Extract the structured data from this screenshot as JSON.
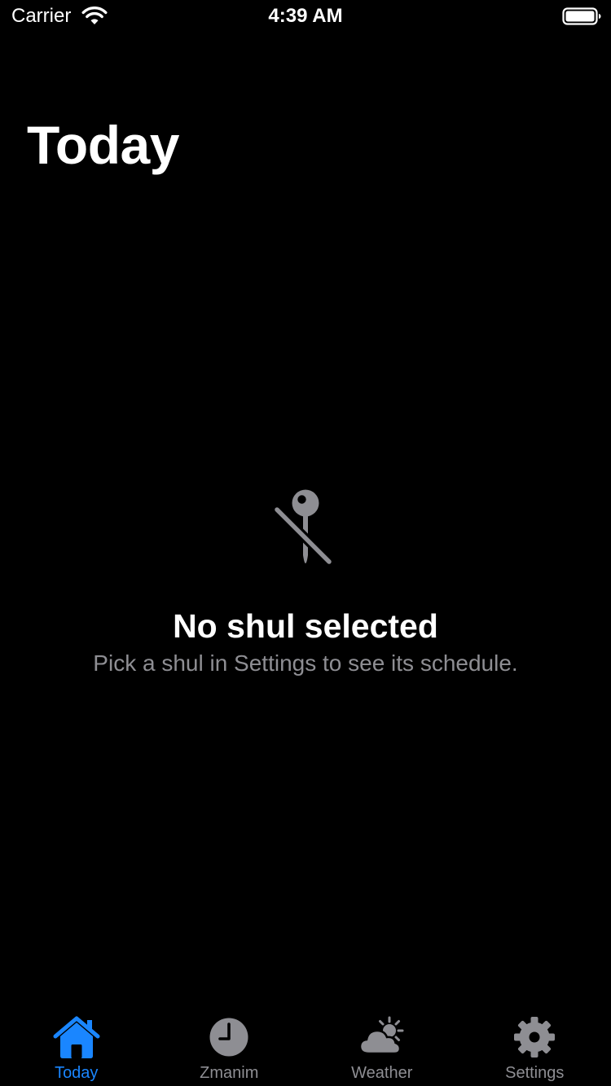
{
  "status_bar": {
    "carrier": "Carrier",
    "time": "4:39 AM"
  },
  "page": {
    "title": "Today"
  },
  "empty_state": {
    "icon": "mappin-slash-icon",
    "title": "No shul selected",
    "subtitle": "Pick a shul in Settings to see its schedule."
  },
  "tab_bar": {
    "active_color": "#1a86ff",
    "inactive_color": "#8e8e93",
    "tabs": [
      {
        "label": "Today",
        "icon": "house-icon",
        "active": true
      },
      {
        "label": "Zmanim",
        "icon": "clock-icon",
        "active": false
      },
      {
        "label": "Weather",
        "icon": "cloud-sun-icon",
        "active": false
      },
      {
        "label": "Settings",
        "icon": "gear-icon",
        "active": false
      }
    ]
  }
}
